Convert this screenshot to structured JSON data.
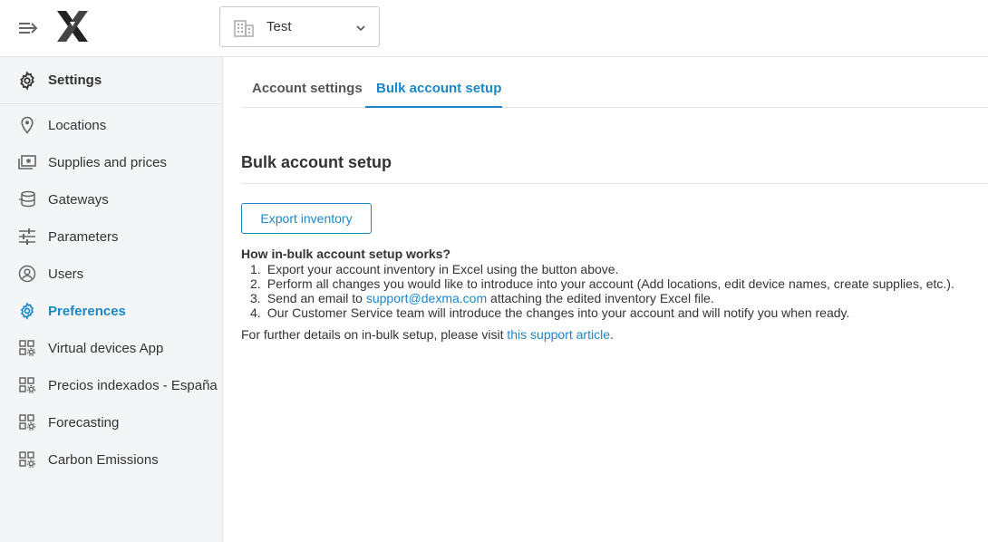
{
  "header": {
    "account_name": "Test"
  },
  "sidebar": {
    "title": "Settings",
    "items": [
      {
        "label": "Locations",
        "icon": "location-pin-icon"
      },
      {
        "label": "Supplies and prices",
        "icon": "money-icon"
      },
      {
        "label": "Gateways",
        "icon": "database-icon"
      },
      {
        "label": "Parameters",
        "icon": "sliders-icon"
      },
      {
        "label": "Users",
        "icon": "user-icon"
      },
      {
        "label": "Preferences",
        "icon": "gear-icon",
        "active": true
      },
      {
        "label": "Virtual devices App",
        "icon": "app-grid-icon"
      },
      {
        "label": "Precios indexados - España",
        "icon": "app-grid-icon"
      },
      {
        "label": "Forecasting",
        "icon": "app-grid-icon"
      },
      {
        "label": "Carbon Emissions",
        "icon": "app-grid-icon"
      }
    ]
  },
  "tabs": {
    "account_settings": "Account settings",
    "bulk_account_setup": "Bulk account setup"
  },
  "main": {
    "section_title": "Bulk account setup",
    "export_button": "Export inventory",
    "how_title": "How in-bulk account setup works?",
    "steps": [
      {
        "num": "1.",
        "text": "Export your account inventory in Excel using the button above."
      },
      {
        "num": "2.",
        "text": "Perform all changes you would like to introduce into your account (Add locations, edit device names, create supplies, etc.)."
      },
      {
        "num": "3.",
        "text_before": "Send an email to ",
        "link": "support@dexma.com",
        "text_after": " attaching the edited inventory Excel file."
      },
      {
        "num": "4.",
        "text": "Our Customer Service team will introduce the changes into your account and will notify you when ready."
      }
    ],
    "further_before": "For further details on in-bulk setup, please visit ",
    "further_link": "this support article",
    "further_after": "."
  },
  "colors": {
    "accent": "#1b87c9",
    "sidebar_bg": "#f4f5f6",
    "text": "#333333"
  }
}
